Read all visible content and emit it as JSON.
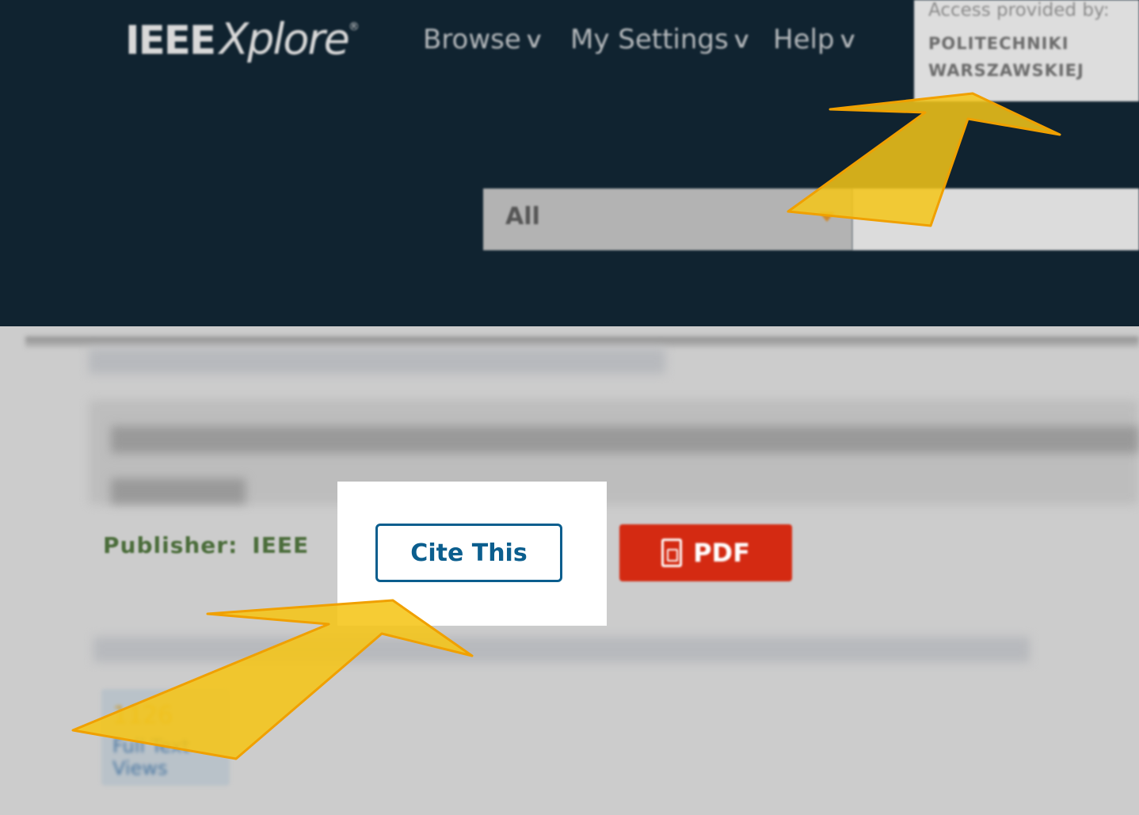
{
  "header": {
    "logo": {
      "brand": "IEEE",
      "product": "Xplore",
      "mark": "®"
    },
    "nav": [
      {
        "label": "Browse",
        "icon": "chevron-down-icon"
      },
      {
        "label": "My Settings",
        "icon": "chevron-down-icon"
      },
      {
        "label": "Help",
        "icon": "chevron-down-icon"
      }
    ],
    "access": {
      "label": "Access provided by:",
      "institution_line1": "POLITECHNIKI",
      "institution_line2": "WARSZAWSKIEJ"
    },
    "search": {
      "scope_value": "All"
    }
  },
  "article": {
    "publisher_label": "Publisher:",
    "publisher_value": "IEEE",
    "cite_label": "Cite This",
    "pdf_label": "PDF",
    "metrics": {
      "count": "1126",
      "label": "Full Text Views"
    }
  },
  "colors": {
    "header_bg": "#102330",
    "cite_accent": "#0b5e8e",
    "pdf_red": "#d42a12",
    "arrow_yellow": "#f5c518",
    "arrow_outline": "#f0a000"
  }
}
